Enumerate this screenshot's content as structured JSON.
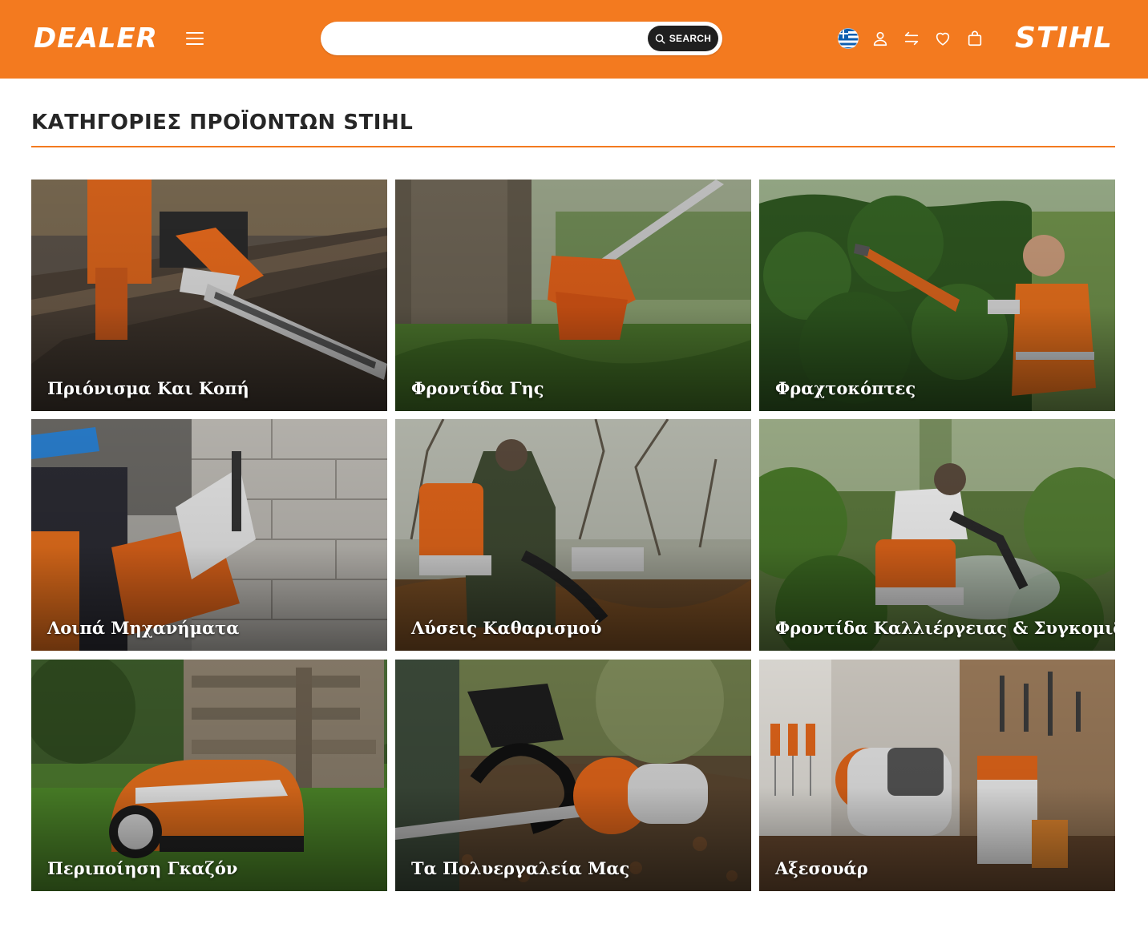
{
  "header": {
    "dealer_logo": "DEALER",
    "brand_logo": "STIHL",
    "search": {
      "placeholder": "",
      "button_label": "SEARCH"
    },
    "language_flag": "greece-flag",
    "icons": [
      "menu-icon",
      "search-icon",
      "user-icon",
      "compare-icon",
      "heart-icon",
      "shopping-bag-icon"
    ]
  },
  "page": {
    "title": "ΚΑΤΗΓΟΡΙΕΣ ΠΡΟΪΟΝΤΩΝ STIHL"
  },
  "categories": [
    {
      "label": "Πριόνισμα Και Κοπή"
    },
    {
      "label": "Φροντίδα Γης"
    },
    {
      "label": "Φραχτοκόπτες"
    },
    {
      "label": "Λοιπά Μηχανήματα"
    },
    {
      "label": "Λύσεις Καθαρισμού"
    },
    {
      "label": "Φροντίδα Καλλιέργειας & Συγκομιδή"
    },
    {
      "label": "Περιποίηση Γκαζόν"
    },
    {
      "label": "Τα Πολυεργαλεία Μας"
    },
    {
      "label": "Αξεσουάρ"
    }
  ],
  "colors": {
    "brand_orange": "#f37a1f",
    "search_button": "#1f1f1f",
    "title_text": "#262626"
  }
}
